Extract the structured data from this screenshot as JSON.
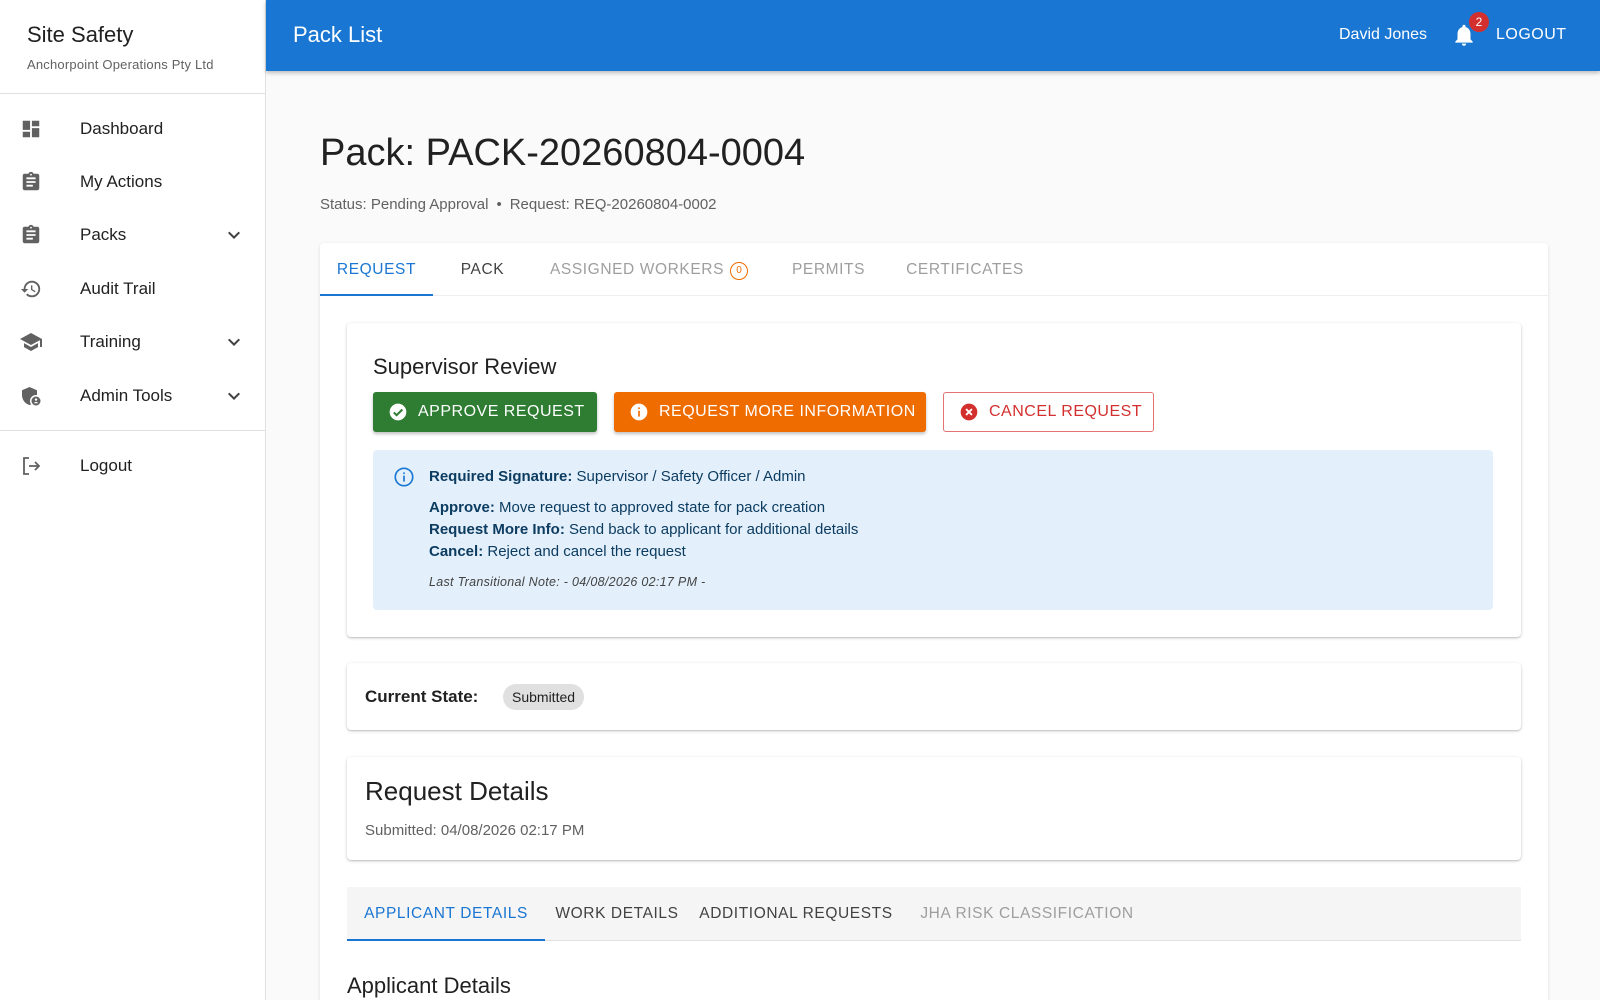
{
  "sidebar": {
    "brand_title": "Site Safety",
    "brand_subtitle": "Anchorpoint Operations Pty Ltd",
    "items": [
      {
        "label": "Dashboard",
        "icon": "dashboard-icon",
        "expandable": false
      },
      {
        "label": "My Actions",
        "icon": "clipboard-icon",
        "expandable": false
      },
      {
        "label": "Packs",
        "icon": "clipboard-icon",
        "expandable": true
      },
      {
        "label": "Audit Trail",
        "icon": "history-icon",
        "expandable": false
      },
      {
        "label": "Training",
        "icon": "graduation-cap-icon",
        "expandable": true
      },
      {
        "label": "Admin Tools",
        "icon": "admin-shield-icon",
        "expandable": true
      }
    ],
    "logout_label": "Logout"
  },
  "appbar": {
    "title": "Pack List",
    "user_name": "David Jones",
    "notification_count": "2",
    "logout_label": "LOGOUT",
    "color": "#1976d2"
  },
  "page": {
    "title": "Pack: PACK-20260804-0004",
    "status": "Status: Pending Approval",
    "separator": "•",
    "request": "Request: REQ-20260804-0002"
  },
  "tabs": [
    {
      "label": "REQUEST",
      "state": "active"
    },
    {
      "label": "PACK",
      "state": "normal"
    },
    {
      "label": "ASSIGNED WORKERS",
      "state": "disabled",
      "badge": "0"
    },
    {
      "label": "PERMITS",
      "state": "disabled"
    },
    {
      "label": "CERTIFICATES",
      "state": "disabled"
    }
  ],
  "review": {
    "title": "Supervisor Review",
    "approve_label": "APPROVE REQUEST",
    "more_info_label": "REQUEST MORE INFORMATION",
    "cancel_label": "CANCEL REQUEST",
    "info": {
      "signature_label": "Required Signature:",
      "signature_value": "Supervisor / Safety Officer / Admin",
      "approve_label": "Approve:",
      "approve_value": "Move request to approved state for pack creation",
      "more_info_label": "Request More Info:",
      "more_info_value": "Send back to applicant for additional details",
      "cancel_label": "Cancel:",
      "cancel_value": "Reject and cancel the request",
      "note": "Last Transitional Note: - 04/08/2026 02:17 PM -"
    }
  },
  "state": {
    "label": "Current State:",
    "value": "Submitted"
  },
  "request_details": {
    "title": "Request Details",
    "submitted": "Submitted: 04/08/2026 02:17 PM"
  },
  "sub_tabs": [
    {
      "label": "APPLICANT DETAILS",
      "state": "active"
    },
    {
      "label": "WORK DETAILS",
      "state": "normal"
    },
    {
      "label": "ADDITIONAL REQUESTS",
      "state": "normal"
    },
    {
      "label": "JHA RISK CLASSIFICATION",
      "state": "disabled"
    }
  ],
  "applicant_section_title": "Applicant Details"
}
